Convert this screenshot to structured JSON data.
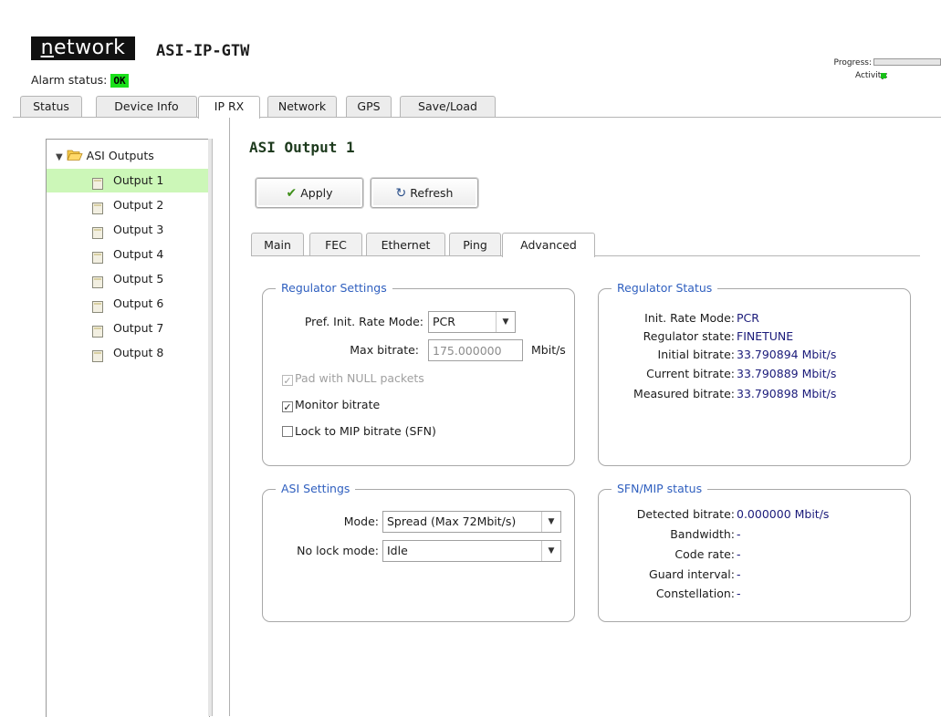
{
  "header": {
    "logo_prefix": "n",
    "logo_rest": "etwork",
    "device_name": "ASI-IP-GTW",
    "alarm_label": "Alarm status:",
    "alarm_value": "OK",
    "alarm_color": "#19e019",
    "progress_label": "Progress:",
    "progress_value": 0,
    "activity_label": "Activity:",
    "activity_color": "#19c019"
  },
  "main_tabs": [
    {
      "label": "Status"
    },
    {
      "label": "Device Info"
    },
    {
      "label": "IP RX",
      "active": true
    },
    {
      "label": "Network"
    },
    {
      "label": "GPS"
    },
    {
      "label": "Save/Load"
    }
  ],
  "tree": {
    "root_label": "ASI Outputs",
    "root_expanded": true,
    "items": [
      {
        "label": "Output 1",
        "selected": true
      },
      {
        "label": "Output 2"
      },
      {
        "label": "Output 3"
      },
      {
        "label": "Output 4"
      },
      {
        "label": "Output 5"
      },
      {
        "label": "Output 6"
      },
      {
        "label": "Output 7"
      },
      {
        "label": "Output 8"
      }
    ],
    "selected_color": "#ccf7b8"
  },
  "panel": {
    "title": "ASI Output 1",
    "apply_label": "Apply",
    "refresh_label": "Refresh"
  },
  "sub_tabs": [
    {
      "label": "Main"
    },
    {
      "label": "FEC"
    },
    {
      "label": "Ethernet"
    },
    {
      "label": "Ping"
    },
    {
      "label": "Advanced",
      "active": true
    }
  ],
  "regulator_settings": {
    "legend": "Regulator Settings",
    "rate_mode_label": "Pref. Init. Rate Mode:",
    "rate_mode_value": "PCR",
    "max_bitrate_label": "Max bitrate:",
    "max_bitrate_value": "175.000000",
    "max_bitrate_unit": "Mbit/s",
    "pad_null_label": "Pad with NULL packets",
    "pad_null_checked": true,
    "pad_null_enabled": false,
    "monitor_label": "Monitor bitrate",
    "monitor_checked": true,
    "lock_mip_label": "Lock to MIP bitrate (SFN)",
    "lock_mip_checked": false
  },
  "regulator_status": {
    "legend": "Regulator Status",
    "rows": [
      {
        "key": "Init. Rate Mode:",
        "value": "PCR"
      },
      {
        "key": "Regulator state:",
        "value": "FINETUNE"
      },
      {
        "key": "Initial bitrate:",
        "value": "33.790894 Mbit/s"
      },
      {
        "key": "Current bitrate:",
        "value": "33.790889 Mbit/s"
      },
      {
        "key": "Measured bitrate:",
        "value": "33.790898 Mbit/s"
      }
    ]
  },
  "asi_settings": {
    "legend": "ASI Settings",
    "mode_label": "Mode:",
    "mode_value": "Spread (Max 72Mbit/s)",
    "no_lock_label": "No lock mode:",
    "no_lock_value": "Idle"
  },
  "sfn_status": {
    "legend": "SFN/MIP status",
    "rows": [
      {
        "key": "Detected bitrate:",
        "value": "0.000000 Mbit/s"
      },
      {
        "key": "Bandwidth:",
        "value": "-"
      },
      {
        "key": "Code rate:",
        "value": "-"
      },
      {
        "key": "Guard interval:",
        "value": "-"
      },
      {
        "key": "Constellation:",
        "value": "-"
      }
    ]
  }
}
